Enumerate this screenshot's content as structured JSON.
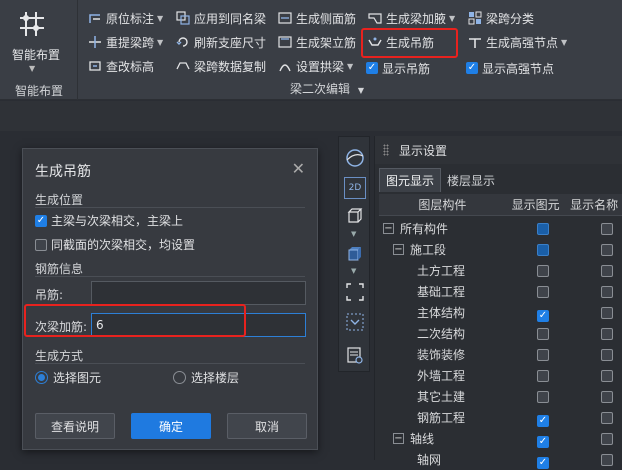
{
  "ribbon": {
    "smart_layout": {
      "label": "智能布置",
      "group_label": "智能布置"
    },
    "buttons": [
      {
        "label": "原位标注",
        "icon": "dimension-icon",
        "caret": true
      },
      {
        "label": "应用到同名梁",
        "icon": "apply-icon"
      },
      {
        "label": "生成侧面筋",
        "icon": "side-bar-icon"
      },
      {
        "label": "生成梁加腋",
        "icon": "haunch-icon",
        "caret": true
      },
      {
        "label": "梁跨分类",
        "icon": "classify-icon"
      },
      {
        "label": "重提梁跨",
        "icon": "respan-icon",
        "caret": true
      },
      {
        "label": "刷新支座尺寸",
        "icon": "refresh-icon"
      },
      {
        "label": "生成架立筋",
        "icon": "erect-bar-icon"
      },
      {
        "label": "生成吊筋",
        "icon": "hanger-icon"
      },
      {
        "label": "生成高强节点",
        "icon": "node-icon",
        "caret": true
      },
      {
        "label": "查改标高",
        "icon": "elevation-icon"
      },
      {
        "label": "梁跨数据复制",
        "icon": "copy-icon"
      },
      {
        "label": "设置拱梁",
        "icon": "arch-icon",
        "caret": true
      },
      {
        "label": "显示吊筋",
        "checked": true
      },
      {
        "label": "显示高强节点",
        "checked": true
      }
    ],
    "section_label": "梁二次编辑"
  },
  "panel": {
    "title": "显示设置",
    "tabs": [
      "图元显示",
      "楼层显示"
    ],
    "columns": [
      "图层构件",
      "显示图元",
      "显示名称"
    ],
    "rows": [
      {
        "name": "所有构件",
        "level": 0,
        "expander": "−",
        "show": "partial",
        "name_shown": false
      },
      {
        "name": "施工段",
        "level": 1,
        "expander": "−",
        "show": "partial",
        "name_shown": false
      },
      {
        "name": "土方工程",
        "level": 2,
        "show": false,
        "name_shown": false
      },
      {
        "name": "基础工程",
        "level": 2,
        "show": false,
        "name_shown": false
      },
      {
        "name": "主体结构",
        "level": 2,
        "show": true,
        "name_shown": false
      },
      {
        "name": "二次结构",
        "level": 2,
        "show": false,
        "name_shown": false
      },
      {
        "name": "装饰装修",
        "level": 2,
        "show": false,
        "name_shown": false
      },
      {
        "name": "外墙工程",
        "level": 2,
        "show": false,
        "name_shown": false
      },
      {
        "name": "其它土建",
        "level": 2,
        "show": false,
        "name_shown": false
      },
      {
        "name": "钢筋工程",
        "level": 2,
        "show": true,
        "name_shown": false
      },
      {
        "name": "轴线",
        "level": 1,
        "expander": "−",
        "show": true,
        "name_shown": false
      },
      {
        "name": "轴网",
        "level": 2,
        "show": true,
        "name_shown": false
      }
    ]
  },
  "dialog": {
    "title": "生成吊筋",
    "section_position": "生成位置",
    "opt_main_beam": "主梁与次梁相交，主梁上",
    "opt_same_section": "同截面的次梁相交，均设置",
    "section_rebar": "钢筋信息",
    "label_hanger": "吊筋:",
    "value_hanger": "",
    "label_secondary": "次梁加筋:",
    "value_secondary": "6",
    "section_method": "生成方式",
    "radio_select_element": "选择图元",
    "radio_select_floor": "选择楼层",
    "btn_help": "查看说明",
    "btn_ok": "确定",
    "btn_cancel": "取消"
  },
  "colors": {
    "accent": "#1f7ae0",
    "highlight": "#e8221e"
  }
}
